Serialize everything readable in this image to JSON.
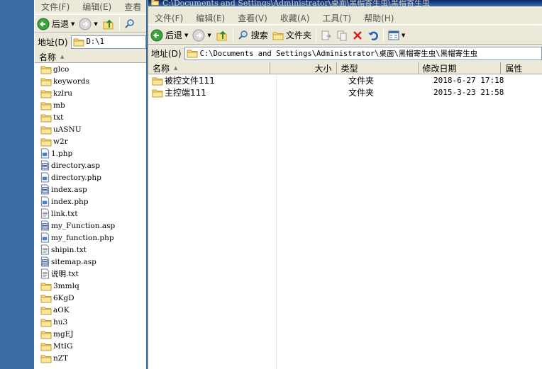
{
  "left_window": {
    "toolbar": {
      "back_label": "后退"
    },
    "menu": [
      "文件(F)",
      "编辑(E)",
      "查看"
    ],
    "address": {
      "label": "地址(D)",
      "value": "D:\\1"
    },
    "list": {
      "header_name": "名称",
      "items": [
        {
          "name": "glco",
          "icon": "folder-icon"
        },
        {
          "name": "keywords",
          "icon": "folder-icon"
        },
        {
          "name": "kzlru",
          "icon": "folder-icon"
        },
        {
          "name": "mb",
          "icon": "folder-icon"
        },
        {
          "name": "txt",
          "icon": "folder-icon"
        },
        {
          "name": "uASNU",
          "icon": "folder-icon"
        },
        {
          "name": "w2r",
          "icon": "folder-icon"
        },
        {
          "name": "1.php",
          "icon": "php-file-icon"
        },
        {
          "name": "directory.asp",
          "icon": "asp-file-icon"
        },
        {
          "name": "directory.php",
          "icon": "php-file-icon"
        },
        {
          "name": "index.asp",
          "icon": "asp-file-icon"
        },
        {
          "name": "index.php",
          "icon": "php-file-icon"
        },
        {
          "name": "link.txt",
          "icon": "text-file-icon"
        },
        {
          "name": "my_Function.asp",
          "icon": "asp-file-icon"
        },
        {
          "name": "my_function.php",
          "icon": "php-file-icon"
        },
        {
          "name": "shipin.txt",
          "icon": "text-file-icon"
        },
        {
          "name": "sitemap.asp",
          "icon": "asp-file-icon"
        },
        {
          "name": "说明.txt",
          "icon": "text-file-icon"
        },
        {
          "name": "3mmlq",
          "icon": "folder-icon"
        },
        {
          "name": "6KgD",
          "icon": "folder-icon"
        },
        {
          "name": "aOK",
          "icon": "folder-icon"
        },
        {
          "name": "hu3",
          "icon": "folder-icon"
        },
        {
          "name": "mgEJ",
          "icon": "folder-icon"
        },
        {
          "name": "MtIG",
          "icon": "folder-icon"
        },
        {
          "name": "nZT",
          "icon": "folder-icon"
        }
      ]
    }
  },
  "right_window": {
    "title": "C:\\Documents and Settings\\Administrator\\桌面\\黑帽寄生虫\\黑帽寄生虫",
    "menu": [
      "文件(F)",
      "编辑(E)",
      "查看(V)",
      "收藏(A)",
      "工具(T)",
      "帮助(H)"
    ],
    "toolbar": {
      "back_label": "后退",
      "search_label": "搜索",
      "folders_label": "文件夹"
    },
    "address": {
      "label": "地址(D)",
      "value": "C:\\Documents and Settings\\Administrator\\桌面\\黑帽寄生虫\\黑帽寄生虫"
    },
    "list": {
      "columns": [
        "名称",
        "大小",
        "类型",
        "修改日期",
        "属性"
      ],
      "rows": [
        {
          "name": "被控文件111",
          "size": "",
          "type": "文件夹",
          "modified": "2018-6-27 17:18"
        },
        {
          "name": "主控端111",
          "size": "",
          "type": "文件夹",
          "modified": "2015-3-23 21:58"
        }
      ]
    }
  },
  "colors": {
    "desktop": "#3a6ea5",
    "window_bg": "#ece9d8",
    "title_active": "#0a246a",
    "folder": "#f5d36c"
  }
}
